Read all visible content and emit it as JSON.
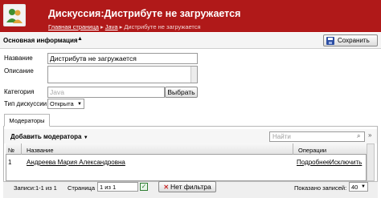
{
  "header": {
    "title": "Дискуссия:Дистрибуте не загружается",
    "breadcrumbs": [
      "Главная страница",
      "Java",
      "Дистрибуте не загружается"
    ],
    "breadcrumb_sep": "▸",
    "bg_color": "#b01919"
  },
  "section": {
    "title": "Основная информация",
    "toggle_glyph": "▲",
    "save_label": "Сохранить"
  },
  "form": {
    "name_label": "Название",
    "name_value": "Дистрибутв не загружается",
    "description_label": "Описание",
    "description_value": "",
    "category_label": "Категория",
    "category_placeholder": "Java",
    "choose_label": "Выбрать",
    "type_label": "Тип дискуссии",
    "type_value": "Открыта"
  },
  "tabs": [
    {
      "label": "Модераторы",
      "active": true
    }
  ],
  "moderators": {
    "add_label": "Добавить модератора",
    "search_placeholder": "Найти",
    "columns": {
      "num": "№",
      "name": "Название",
      "ops": "Операции"
    },
    "rows": [
      {
        "num": "1",
        "name": "Андреева Мария Александровна",
        "op_more": "Подробнее",
        "op_exclude": "Исключить"
      }
    ]
  },
  "pager": {
    "records": "Записи:1-1 из 1",
    "page_label": "Страница",
    "page_value": "1 из 1",
    "no_filter": "Нет фильтра",
    "per_page_label": "Показано записей:",
    "per_page_value": "40"
  }
}
